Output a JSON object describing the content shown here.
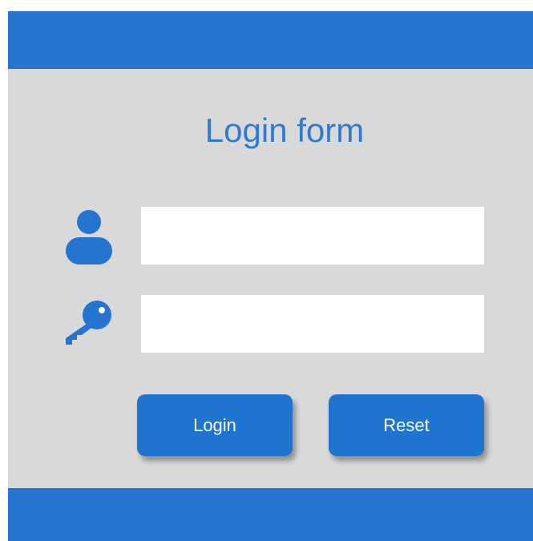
{
  "form": {
    "title": "Login form",
    "username": {
      "value": "",
      "placeholder": ""
    },
    "password": {
      "value": "",
      "placeholder": ""
    },
    "login_label": "Login",
    "reset_label": "Reset"
  },
  "icons": {
    "user": "user-icon",
    "key": "key-icon"
  },
  "colors": {
    "accent": "#2474d0",
    "background": "#d9d9d9",
    "title": "#2f7bd1",
    "button": "#1f74cf"
  }
}
